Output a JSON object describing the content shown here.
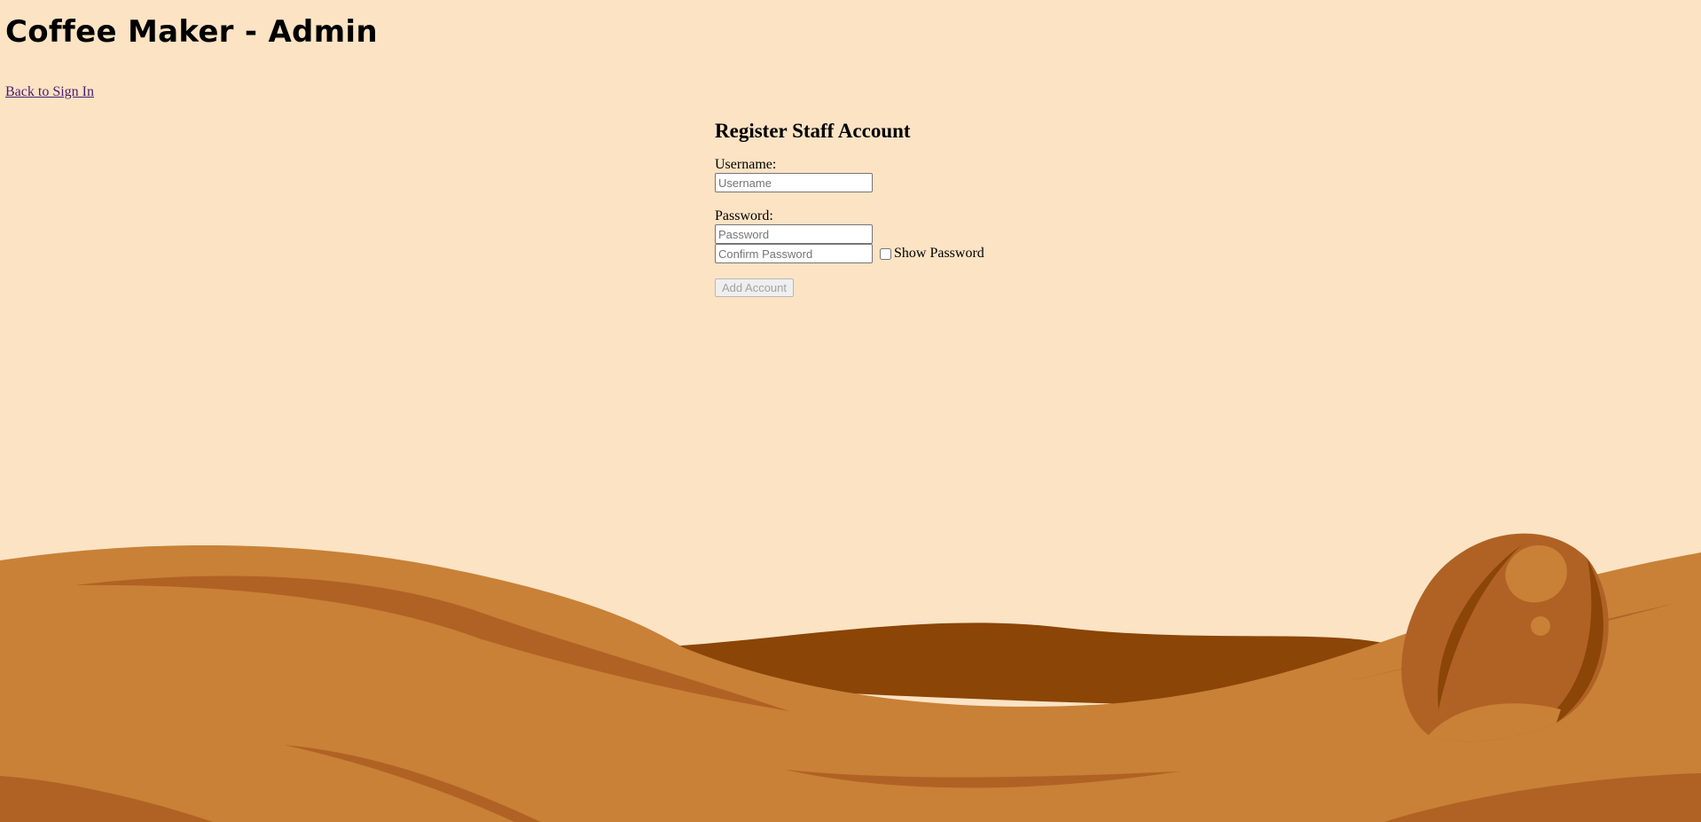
{
  "app": {
    "title": "Coffee Maker - Admin",
    "back_link": "Back to Sign In"
  },
  "form": {
    "title": "Register Staff Account",
    "username_label": "Username:",
    "username_placeholder": "Username",
    "username_value": "",
    "password_label": "Password:",
    "password_placeholder": "Password",
    "confirm_placeholder": "Confirm Password",
    "show_password_label": "Show Password",
    "show_password_checked": false,
    "submit_label": "Add Account",
    "submit_disabled": true
  },
  "theme": {
    "background": "#fce3c4",
    "hill_light": "#c88137",
    "hill_mid": "#b06224",
    "hill_dark": "#8b4506",
    "bean_body": "#b06224",
    "bean_highlight": "#c88137",
    "bean_crease": "#8b4506"
  }
}
